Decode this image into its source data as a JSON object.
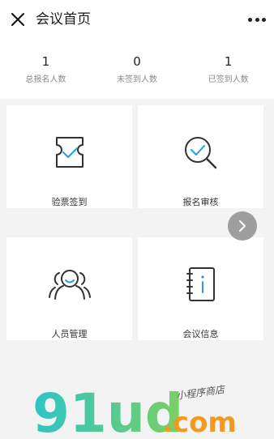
{
  "header": {
    "title": "会议首页"
  },
  "stats": [
    {
      "value": "1",
      "label": "总报名人数"
    },
    {
      "value": "0",
      "label": "未签到人数"
    },
    {
      "value": "1",
      "label": "已签到人数"
    }
  ],
  "menu": [
    {
      "label": "验票签到"
    },
    {
      "label": "报名审核"
    },
    {
      "label": "人员管理"
    },
    {
      "label": "会议信息"
    }
  ],
  "watermark": {
    "brand": "91ud",
    "suffix": ".com",
    "tagline": "小程序商店"
  },
  "colors": {
    "accent": "#2a9bd8",
    "icon": "#333333",
    "primary_text": "#1a1a1a",
    "secondary_text": "#8a8a8a"
  }
}
